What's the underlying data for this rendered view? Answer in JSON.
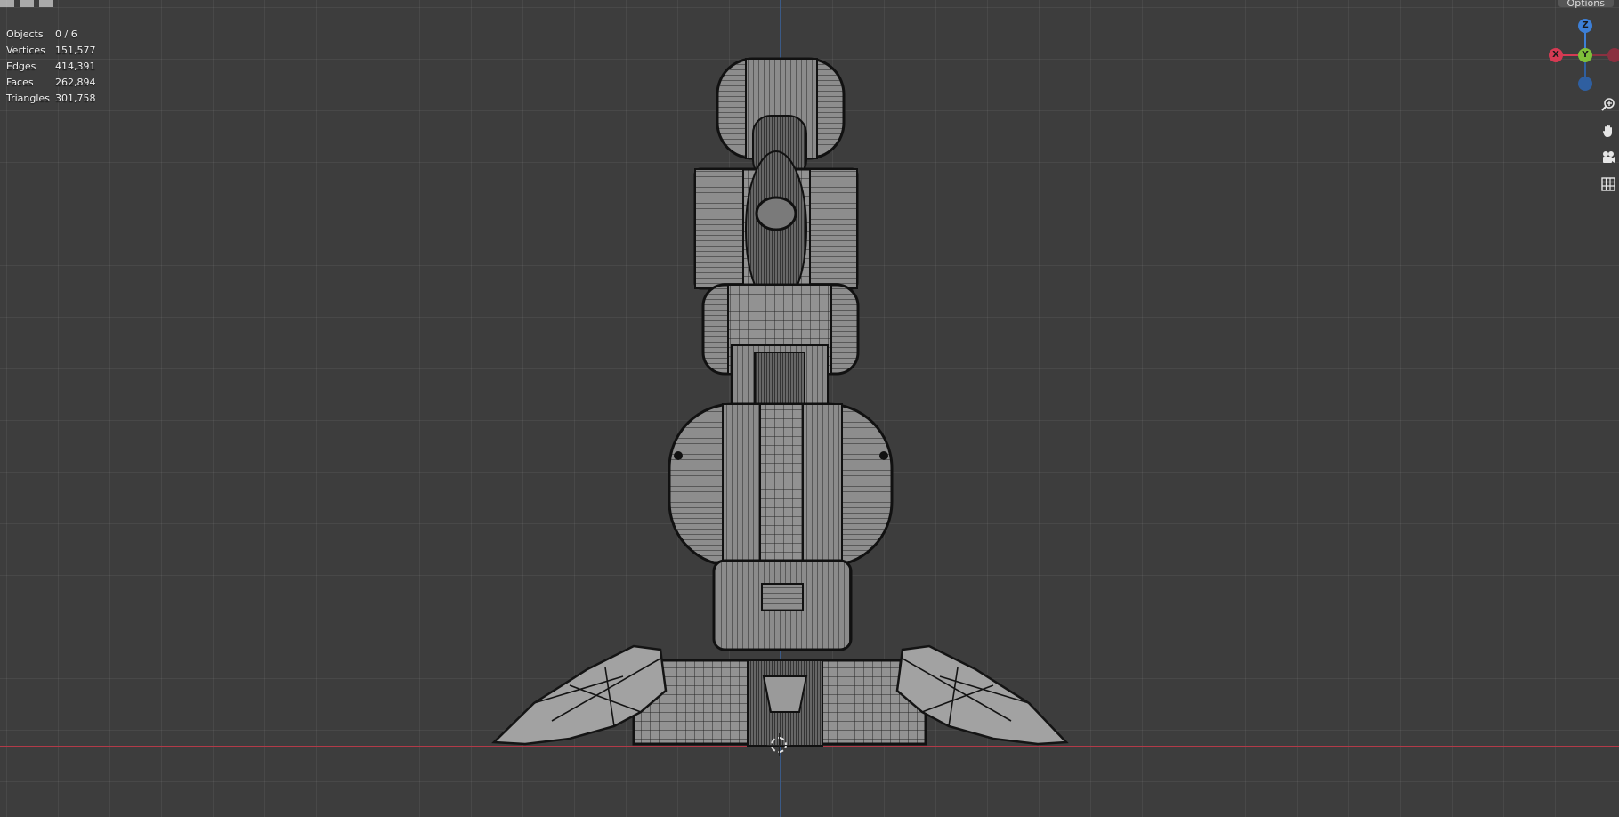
{
  "header": {
    "options_label": "Options"
  },
  "stats": [
    {
      "label": "Objects",
      "value": "0 / 6"
    },
    {
      "label": "Vertices",
      "value": "151,577"
    },
    {
      "label": "Edges",
      "value": "414,391"
    },
    {
      "label": "Faces",
      "value": "262,894"
    },
    {
      "label": "Triangles",
      "value": "301,758"
    }
  ],
  "gizmo": {
    "z_label": "Z",
    "y_label": "Y",
    "x_label": "X",
    "colors": {
      "z": "#3d7fd6",
      "y": "#7fbf3a",
      "x": "#d63a53",
      "neg": "#2f5fa0"
    }
  },
  "nav_tools": [
    "zoom-icon",
    "pan-hand-icon",
    "camera-icon",
    "grid-perspective-icon"
  ],
  "viewport": {
    "background": "#3d3d3d",
    "mesh_fill": "#8f8f8f",
    "mesh_wire": "#1e1e1e"
  }
}
